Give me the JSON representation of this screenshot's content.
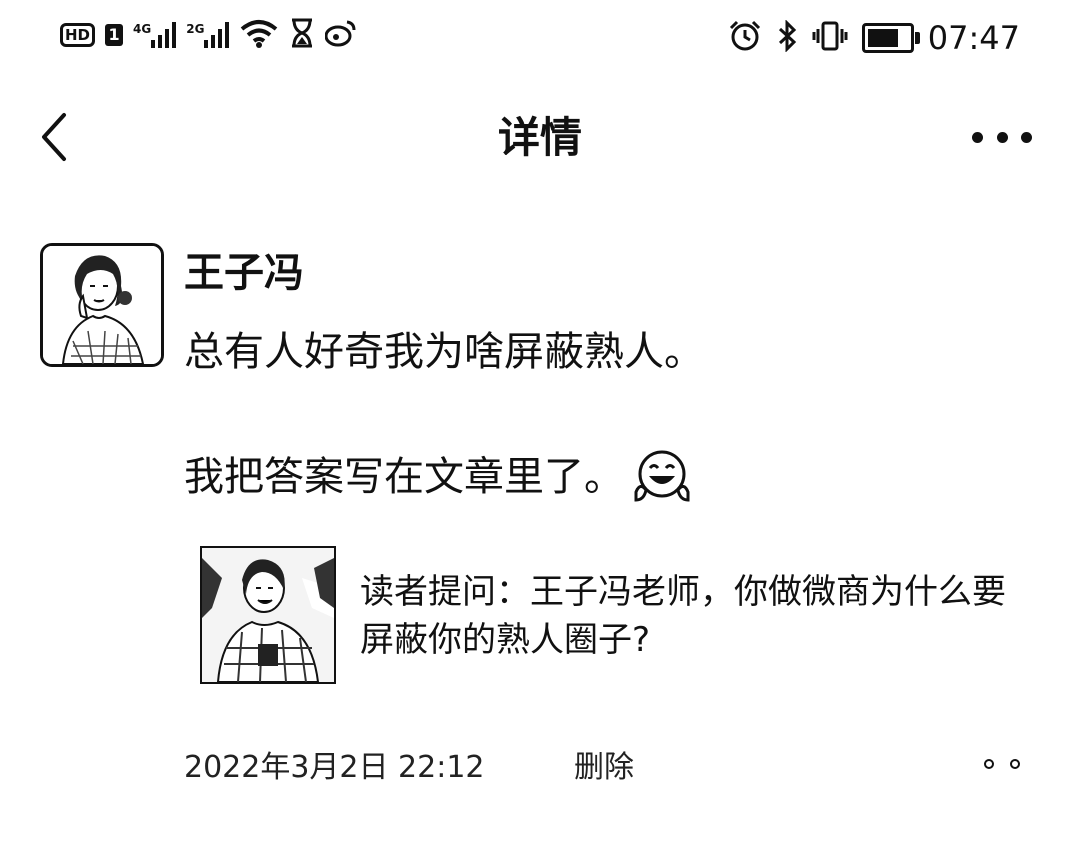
{
  "status_bar": {
    "hd_label": "HD",
    "sim_label": "1",
    "net1": "4G",
    "net2": "2G",
    "time": "07:47",
    "battery_level": 0.75,
    "icons": [
      "hd-icon",
      "sim-icon",
      "signal-4g-icon",
      "signal-2g-icon",
      "wifi-icon",
      "hourglass-icon",
      "weibo-icon",
      "alarm-icon",
      "bluetooth-icon",
      "vibrate-icon",
      "battery-icon"
    ]
  },
  "header": {
    "title": "详情",
    "back_icon": "chevron-left-icon",
    "more_icon": "more-horizontal-icon"
  },
  "post": {
    "author": "王子冯",
    "text_line1": "总有人好奇我为啥屏蔽熟人。",
    "text_line2": "我把答案写在文章里了。",
    "emoji": "laughing-emoji-icon",
    "link_card": {
      "title": "读者提问：王子冯老师，你做微商为什么要屏蔽你的熟人圈子?"
    },
    "timestamp": "2022年3月2日 22:12",
    "delete_label": "删除",
    "actions_icon": "comment-like-dots-icon"
  },
  "colors": {
    "text": "#111111",
    "background": "#ffffff"
  }
}
